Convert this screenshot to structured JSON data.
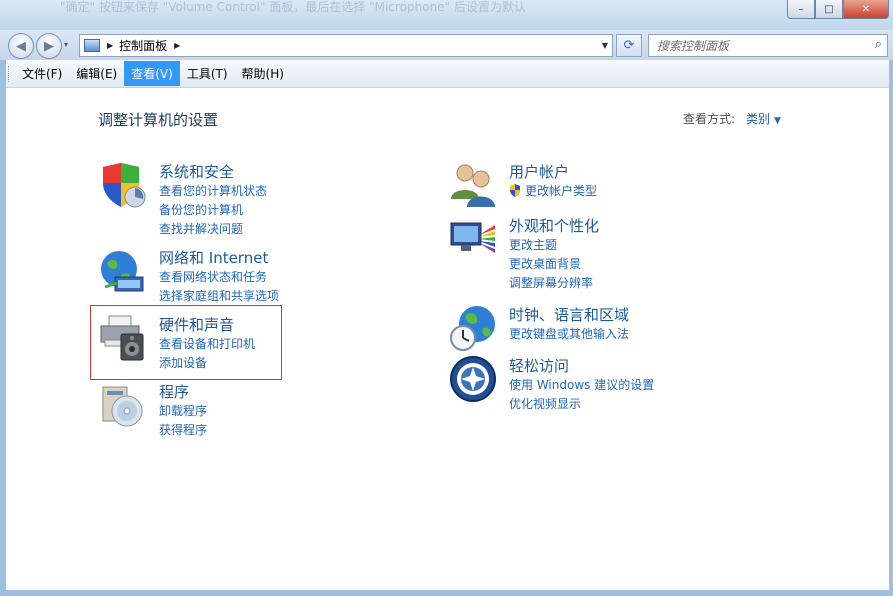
{
  "window": {
    "ghost_text": "\"确定\" 按钮来保存 \"Volume Control\" 面板，最后在选择 \"Microphone\" 后设置为默认",
    "minimize_glyph": "–",
    "maximize_glyph": "□",
    "close_glyph": "✕"
  },
  "navbar": {
    "back_glyph": "◀",
    "forward_glyph": "▶",
    "history_glyph": "▾",
    "breadcrumb_arrow": "▶",
    "breadcrumb": "控制面板",
    "breadcrumb_end_arrow": "▶",
    "address_dropdown_glyph": "▼",
    "refresh_glyph": "⟳",
    "search_placeholder": "搜索控制面板",
    "search_glyph": "⌕"
  },
  "menubar": {
    "items": [
      {
        "label": "文件(F)",
        "active": false
      },
      {
        "label": "编辑(E)",
        "active": false
      },
      {
        "label": "查看(V)",
        "active": true
      },
      {
        "label": "工具(T)",
        "active": false
      },
      {
        "label": "帮助(H)",
        "active": false
      }
    ]
  },
  "main": {
    "title": "调整计算机的设置",
    "view_by_label": "查看方式:",
    "view_by_value": "类别",
    "view_by_glyph": "▼"
  },
  "categories": [
    {
      "key": "system-security",
      "title": "系统和安全",
      "icon": "shield-security-icon",
      "links": [
        "查看您的计算机状态",
        "备份您的计算机",
        "查找并解决问题"
      ]
    },
    {
      "key": "network-internet",
      "title": "网络和 Internet",
      "icon": "globe-network-icon",
      "links": [
        "查看网络状态和任务",
        "选择家庭组和共享选项"
      ]
    },
    {
      "key": "hardware-sound",
      "title": "硬件和声音",
      "icon": "printer-speaker-icon",
      "links": [
        "查看设备和打印机",
        "添加设备"
      ]
    },
    {
      "key": "programs",
      "title": "程序",
      "icon": "programs-disc-icon",
      "links": [
        "卸载程序",
        "获得程序"
      ]
    },
    {
      "key": "user-accounts",
      "title": "用户帐户",
      "icon": "users-icon",
      "links": [
        "更改帐户类型"
      ]
    },
    {
      "key": "appearance",
      "title": "外观和个性化",
      "icon": "monitor-palette-icon",
      "links": [
        "更改主题",
        "更改桌面背景",
        "调整屏幕分辨率"
      ]
    },
    {
      "key": "clock-region",
      "title": "时钟、语言和区域",
      "icon": "clock-globe-icon",
      "links": [
        "更改键盘或其他输入法"
      ]
    },
    {
      "key": "ease-of-access",
      "title": "轻松访问",
      "icon": "ease-of-access-icon",
      "links": [
        "使用 Windows 建议的设置",
        "优化视频显示"
      ]
    }
  ],
  "colors": {
    "link": "#1f67b8",
    "category_title": "#1c5a9c",
    "highlight_border": "#d43b2e",
    "menu_active": "#3399ff"
  }
}
